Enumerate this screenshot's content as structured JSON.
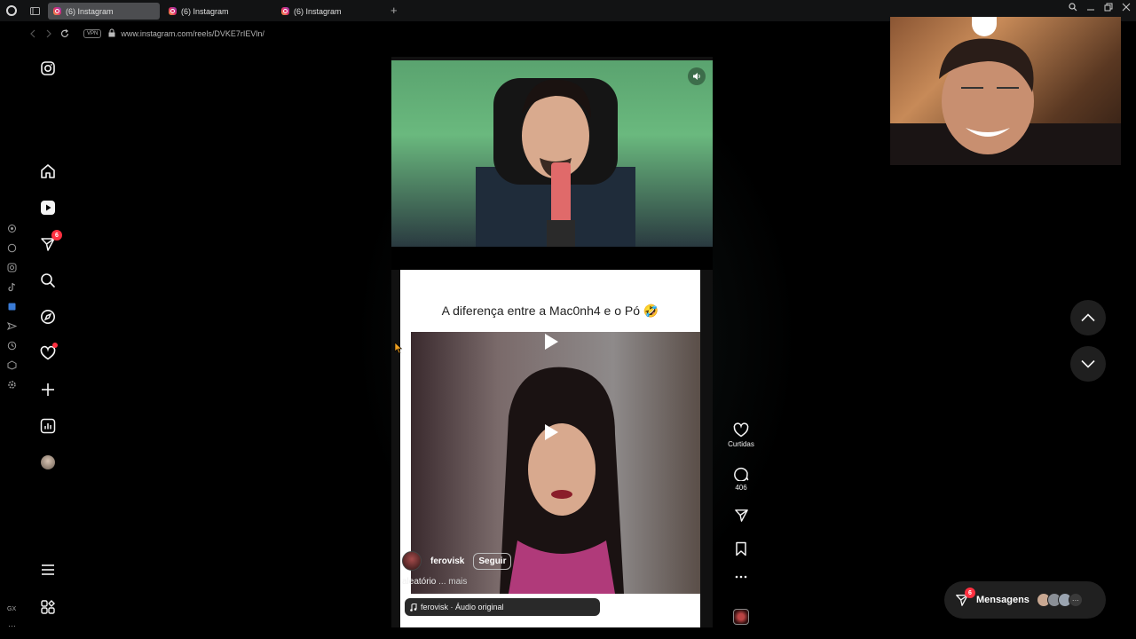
{
  "browser": {
    "tabs": [
      {
        "title": "(6) Instagram",
        "active": true
      },
      {
        "title": "(6) Instagram",
        "active": false
      },
      {
        "title": "(6) Instagram",
        "active": false
      }
    ],
    "vpn_label": "VPN",
    "url": "www.instagram.com/reels/DVKE7rIEVln/",
    "gx_label": "GX"
  },
  "ig_nav": {
    "items": [
      {
        "name": "instagram-logo-icon"
      },
      {
        "name": "home-icon"
      },
      {
        "name": "reels-icon"
      },
      {
        "name": "direct-icon",
        "badge": "6"
      },
      {
        "name": "search-icon"
      },
      {
        "name": "explore-icon"
      },
      {
        "name": "notifications-icon"
      },
      {
        "name": "create-icon"
      },
      {
        "name": "dashboard-icon"
      },
      {
        "name": "profile-avatar"
      },
      {
        "name": "menu-icon"
      },
      {
        "name": "also-from-meta-icon"
      }
    ]
  },
  "reel": {
    "caption_overlay": "A diferença entre a Mac0nh4 e o Pó 🤣",
    "author": "ferovisk",
    "follow_label": "Seguir",
    "caption_text": "aleatório",
    "caption_more": "... mais",
    "audio": "ferovisk · Áudio original"
  },
  "actions": {
    "likes_label": "Curtidas",
    "comments_count": "406"
  },
  "messages": {
    "label": "Mensagens",
    "badge": "6"
  },
  "colors": {
    "badge": "#ff3040",
    "background": "#000000"
  }
}
